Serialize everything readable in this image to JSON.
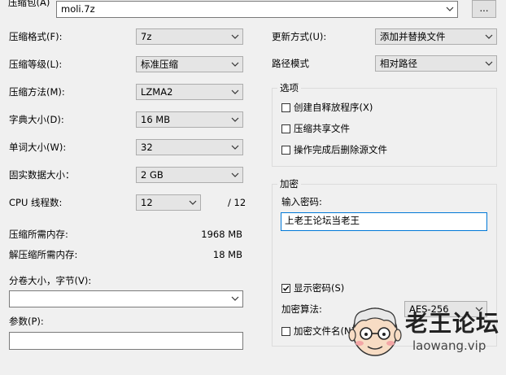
{
  "archive": {
    "label": "压缩包(A)",
    "value": "moli.7z",
    "browse_label": "..."
  },
  "left": {
    "format": {
      "label": "压缩格式(F):",
      "value": "7z"
    },
    "level": {
      "label": "压缩等级(L):",
      "value": "标准压缩"
    },
    "method": {
      "label": "压缩方法(M):",
      "value": "LZMA2"
    },
    "dict": {
      "label": "字典大小(D):",
      "value": "16 MB"
    },
    "word": {
      "label": "单词大小(W):",
      "value": "32"
    },
    "solid": {
      "label": "固实数据大小：",
      "value": "2 GB"
    },
    "threads": {
      "label": "CPU 线程数:",
      "value": "12",
      "max": "/ 12"
    },
    "mem_compress": {
      "label": "压缩所需内存:",
      "value": "1968 MB"
    },
    "mem_decompress": {
      "label": "解压缩所需内存:",
      "value": "18 MB"
    },
    "split": {
      "label": "分卷大小，字节(V):",
      "value": ""
    },
    "params": {
      "label": "参数(P):",
      "value": ""
    }
  },
  "right": {
    "update": {
      "label": "更新方式(U):",
      "value": "添加并替换文件"
    },
    "path": {
      "label": "路径模式",
      "value": "相对路径"
    },
    "options": {
      "title": "选项",
      "items": [
        {
          "label": "创建自释放程序(X)",
          "checked": false
        },
        {
          "label": "压缩共享文件",
          "checked": false
        },
        {
          "label": "操作完成后删除源文件",
          "checked": false
        }
      ]
    },
    "encryption": {
      "title": "加密",
      "password_label": "输入密码:",
      "password_value": "上老王论坛当老王",
      "show_password": {
        "label": "显示密码(S)",
        "checked": true
      },
      "algo_label": "加密算法:",
      "algo_value": "AES-256",
      "encrypt_names": {
        "label": "加密文件名(N)",
        "checked": false
      }
    }
  },
  "watermark": {
    "title": "老王论坛",
    "url": "laowang.vip"
  }
}
